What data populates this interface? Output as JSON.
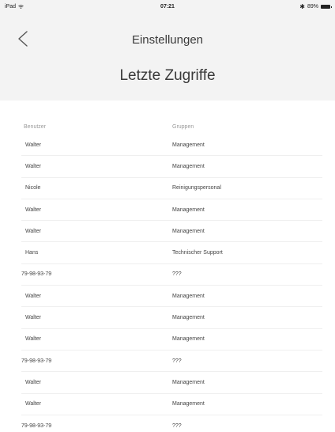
{
  "status_bar": {
    "device": "iPad",
    "time": "07:21",
    "battery": "89%"
  },
  "nav": {
    "back_icon": "chevron-left-icon",
    "title": "Einstellungen"
  },
  "page_title": "Letzte Zugriffe",
  "table": {
    "columns": [
      "Benutzer",
      "Gruppen"
    ],
    "rows": [
      {
        "user": "Walter",
        "group": "Management"
      },
      {
        "user": "Walter",
        "group": "Management"
      },
      {
        "user": "Nicole",
        "group": "Reinigungspersonal"
      },
      {
        "user": "Walter",
        "group": "Management"
      },
      {
        "user": "Walter",
        "group": "Management"
      },
      {
        "user": "Hans",
        "group": "Technischer Support"
      },
      {
        "user": "79-98-93-79",
        "group": "???"
      },
      {
        "user": "Walter",
        "group": "Management"
      },
      {
        "user": "Walter",
        "group": "Management"
      },
      {
        "user": "Walter",
        "group": "Management"
      },
      {
        "user": "79-98-93-79",
        "group": "???"
      },
      {
        "user": "Walter",
        "group": "Management"
      },
      {
        "user": "Walter",
        "group": "Management"
      },
      {
        "user": "79-98-93-79",
        "group": "???"
      }
    ]
  }
}
